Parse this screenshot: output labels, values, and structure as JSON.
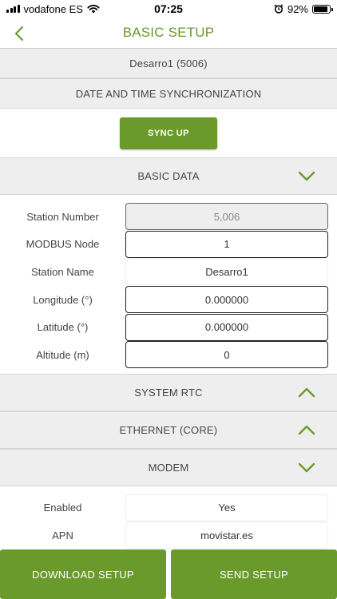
{
  "status_bar": {
    "carrier": "vodafone ES",
    "time": "07:25",
    "battery_percent": "92%",
    "battery_level": 0.92,
    "icons": [
      "signal-icon",
      "wifi-icon",
      "alarm-icon",
      "battery-icon"
    ]
  },
  "nav": {
    "title": "BASIC SETUP",
    "back_icon": "chevron-left-icon"
  },
  "device": {
    "name": "Desarro1 (5006)"
  },
  "date_time": {
    "header": "DATE AND TIME SYNCHRONIZATION",
    "sync_button": "SYNC UP"
  },
  "basic_data": {
    "header": "BASIC DATA",
    "expanded": true,
    "fields": [
      {
        "label": "Station Number",
        "value": "5,006"
      },
      {
        "label": "MODBUS Node",
        "value": "1"
      },
      {
        "label": "Station Name",
        "value": "Desarro1"
      },
      {
        "label": "Longitude (°)",
        "value": "0.000000"
      },
      {
        "label": "Latitude (°)",
        "value": "0.000000"
      },
      {
        "label": "Altitude (m)",
        "value": "0"
      }
    ]
  },
  "sections": [
    {
      "header": "SYSTEM RTC",
      "expanded": false
    },
    {
      "header": "ETHERNET (CORE)",
      "expanded": false
    },
    {
      "header": "MODEM",
      "expanded": true
    }
  ],
  "modem": {
    "fields": [
      {
        "label": "Enabled",
        "value": "Yes"
      },
      {
        "label": "APN",
        "value": "movistar.es"
      }
    ]
  },
  "footer": {
    "download_button": "DOWNLOAD SETUP",
    "send_button": "SEND SETUP"
  },
  "colors": {
    "accent": "#6a9a2c",
    "section_bg": "#eeeeee"
  }
}
